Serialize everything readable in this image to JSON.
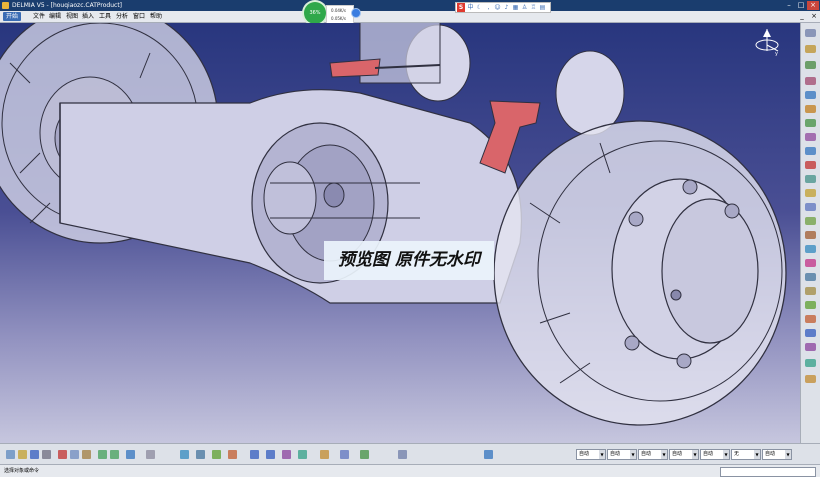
{
  "window": {
    "title": "DELMIA V5 - [houqiaozc.CATProduct]"
  },
  "menu": {
    "start": "开始",
    "items": [
      "文件",
      "编辑",
      "视图",
      "插入",
      "工具",
      "分析",
      "窗口",
      "帮助"
    ]
  },
  "net_widget": {
    "percent": "36%",
    "upload": "0.04K/s",
    "download": "0.05K/s"
  },
  "watermark": {
    "text": "预览图 原件无水印"
  },
  "compass": {
    "label": "y"
  },
  "right_toolbar_icons": [
    "select-icon",
    "sketch-icon",
    "product-icon",
    "component-icon",
    "part-icon",
    "assembly-icon",
    "constraint-icon",
    "catalog-icon",
    "move-icon",
    "snap-icon",
    "explode-icon",
    "clash-icon",
    "section-icon",
    "distance-icon",
    "measure-icon",
    "annotation-icon",
    "view-icon",
    "scene-icon",
    "publish-icon",
    "manip-icon",
    "bom-icon",
    "properties-icon",
    "simulation-icon",
    "kinematics-icon",
    "render-icon"
  ],
  "bottom_toolbar_icons": [
    "new-icon",
    "open-icon",
    "save-icon",
    "print-icon",
    "cut-icon",
    "copy-icon",
    "paste-icon",
    "undo-icon",
    "redo-icon",
    "whats-this-icon",
    "formula-icon",
    "fly-icon",
    "fit-all-icon",
    "pan-icon",
    "rotate-icon",
    "zoom-in-icon",
    "zoom-out-icon",
    "normal-view-icon",
    "iso-view-icon",
    "shading-icon",
    "hide-show-icon",
    "swap-icon",
    "grid-icon",
    "update-icon"
  ],
  "combos": [
    {
      "value": "自动"
    },
    {
      "value": "自动"
    },
    {
      "value": "自动"
    },
    {
      "value": "自动"
    },
    {
      "value": "自动"
    },
    {
      "value": "无"
    },
    {
      "value": "自动"
    }
  ],
  "status": {
    "text": "选择对象或命令"
  }
}
